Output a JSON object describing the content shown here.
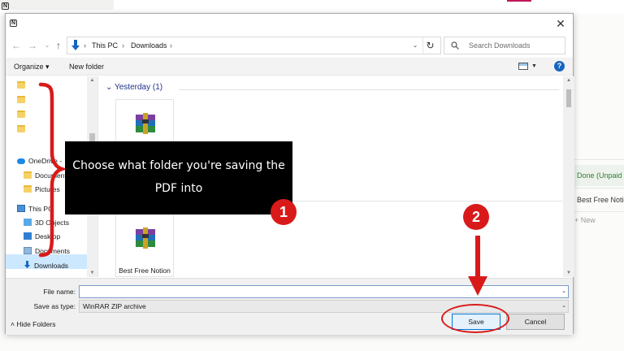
{
  "background": {
    "status_done": "Done (Unpaid",
    "page_item": "Best Free Notio",
    "new_label": "+ New"
  },
  "dialog": {
    "close_glyph": "✕",
    "address": {
      "crumbs": [
        "This PC",
        "Downloads"
      ],
      "separator": "›"
    },
    "search": {
      "placeholder": "Search Downloads"
    },
    "toolbar": {
      "organize": "Organize ▾",
      "new_folder": "New folder",
      "help": "?"
    },
    "nav": {
      "items": [
        {
          "label": "",
          "icon": "folder-icon"
        },
        {
          "label": "",
          "icon": "folder-icon"
        },
        {
          "label": "",
          "icon": "folder-icon"
        },
        {
          "label": "",
          "icon": "folder-icon"
        },
        {
          "label": "OneDrive -",
          "icon": "cloud-icon"
        },
        {
          "label": "Documents",
          "icon": "folder-icon"
        },
        {
          "label": "Pictures",
          "icon": "folder-icon"
        },
        {
          "label": "This PC",
          "icon": "computer-icon"
        },
        {
          "label": "3D Objects",
          "icon": "cube-icon"
        },
        {
          "label": "Desktop",
          "icon": "desktop-icon"
        },
        {
          "label": "Documents",
          "icon": "documents-icon"
        },
        {
          "label": "Downloads",
          "icon": "download-arrow-icon"
        }
      ],
      "selected": "Downloads"
    },
    "content": {
      "group_header": "Yesterday (1)",
      "files": [
        {
          "name": "",
          "icon": "winrar-archive-icon"
        },
        {
          "name": "Best Free Notion",
          "icon": "winrar-archive-icon"
        }
      ]
    },
    "form": {
      "file_name_label": "File name:",
      "file_name_value": "",
      "save_as_label": "Save as type:",
      "save_as_value": "WinRAR ZIP archive",
      "hide_folders": "Hide Folders",
      "save": "Save",
      "cancel": "Cancel"
    }
  },
  "annotations": {
    "callout_text": "Choose what folder you're saving the PDF into",
    "step1": "1",
    "step2": "2",
    "accent_color": "#d91a1a"
  }
}
